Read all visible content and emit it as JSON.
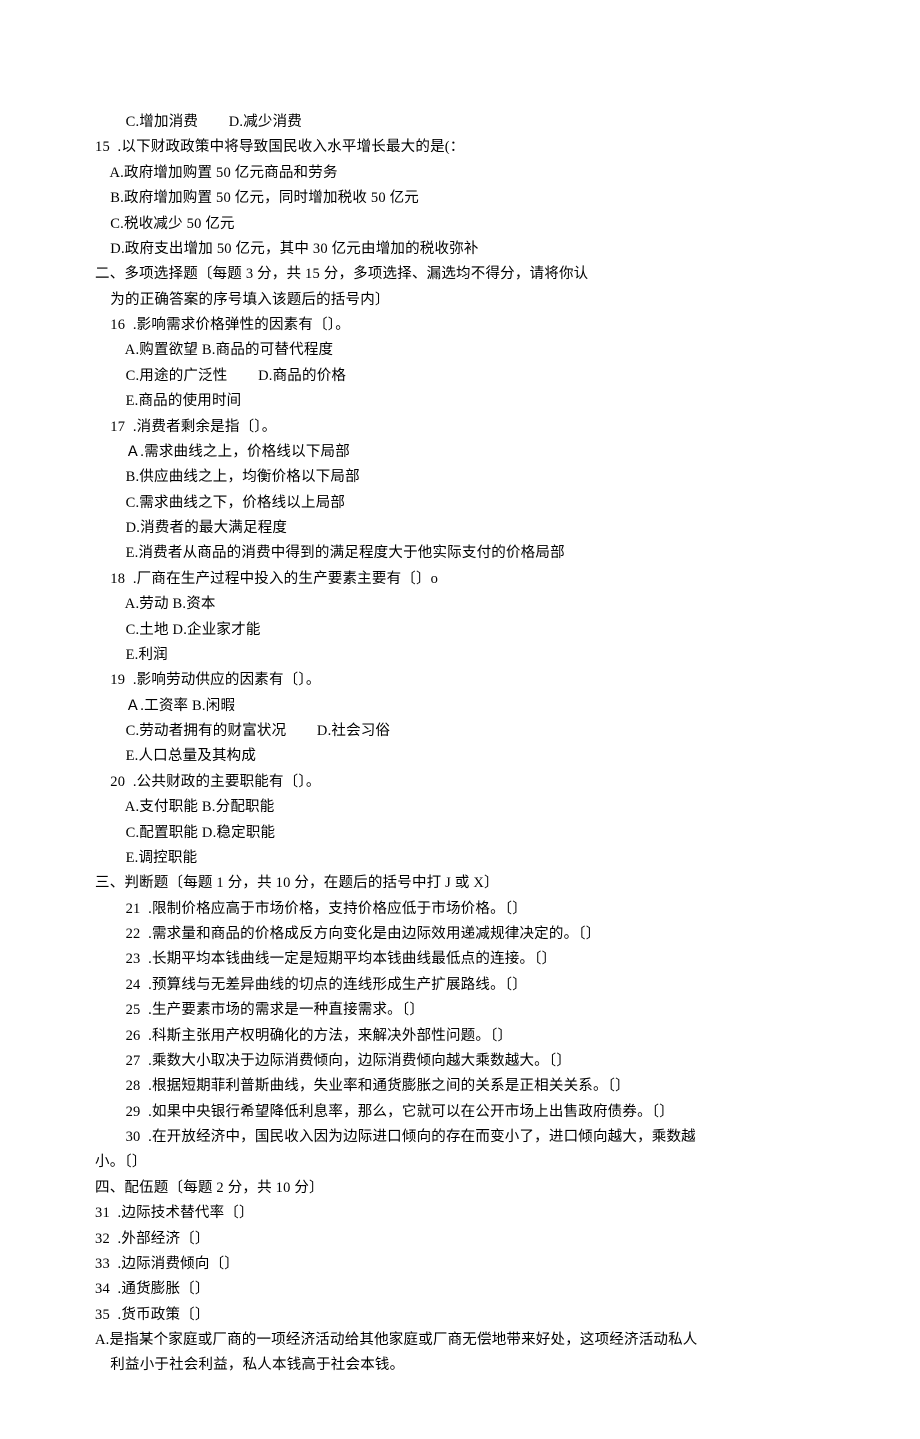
{
  "lines": [
    "        C.增加消费        D.减少消费",
    "15  .以下财政政策中将导致国民收入水平增长最大的是(：",
    "    A.政府增加购置 50 亿元商品和劳务",
    "    B.政府增加购置 50 亿元，同时增加税收 50 亿元",
    "    C.税收减少 50 亿元",
    "    D.政府支出增加 50 亿元，其中 30 亿元由增加的税收弥补",
    "二、多项选择题〔每题 3 分，共 15 分，多项选择、漏选均不得分，请将你认",
    "    为的正确答案的序号填入该题后的括号内〕",
    "    16  .影响需求价格弹性的因素有〔〕。",
    "        A.购置欲望 B.商品的可替代程度",
    "        C.用途的广泛性        D.商品的价格",
    "        E.商品的使用时间",
    "    17  .消费者剩余是指〔〕。",
    "        Ａ.需求曲线之上，价格线以下局部",
    "        B.供应曲线之上，均衡价格以下局部",
    "        C.需求曲线之下，价格线以上局部",
    "        D.消费者的最大满足程度",
    "        E.消费者从商品的消费中得到的满足程度大于他实际支付的价格局部",
    "    18  .厂商在生产过程中投入的生产要素主要有〔〕o",
    "        A.劳动 B.资本",
    "        C.土地 D.企业家才能",
    "        E.利润",
    "    19  .影响劳动供应的因素有〔〕。",
    "        Ａ.工资率 B.闲暇",
    "        C.劳动者拥有的财富状况        D.社会习俗",
    "        E.人口总量及其构成",
    "    20  .公共财政的主要职能有〔〕。",
    "        A.支付职能 B.分配职能",
    "        C.配置职能 D.稳定职能",
    "        E.调控职能",
    "三、判断题〔每题 1 分，共 10 分，在题后的括号中打 J 或 X〕",
    "        21  .限制价格应高于市场价格，支持价格应低于市场价格。〔〕",
    "        22  .需求量和商品的价格成反方向变化是由边际效用递减规律决定的。〔〕",
    "        23  .长期平均本钱曲线一定是短期平均本钱曲线最低点的连接。〔〕",
    "        24  .预算线与无差异曲线的切点的连线形成生产扩展路线。〔〕",
    "        25  .生产要素市场的需求是一种直接需求。〔〕",
    "        26  .科斯主张用产权明确化的方法，来解决外部性问题。〔〕",
    "        27  .乘数大小取决于边际消费倾向，边际消费倾向越大乘数越大。〔〕",
    "        28  .根据短期菲利普斯曲线，失业率和通货膨胀之间的关系是正相关关系。〔〕",
    "        29  .如果中央银行希望降低利息率，那么，它就可以在公开市场上出售政府债券。〔〕",
    "        30  .在开放经济中，国民收入因为边际进口倾向的存在而变小了，进口倾向越大，乘数越",
    "小。〔〕",
    "四、配伍题〔每题 2 分，共 10 分〕",
    "31  .边际技术替代率〔〕",
    "32  .外部经济〔〕",
    "33  .边际消费倾向〔〕",
    "34  .通货膨胀〔〕",
    "35  .货币政策〔〕",
    "A.是指某个家庭或厂商的一项经济活动给其他家庭或厂商无偿地带来好处，这项经济活动私人",
    "    利益小于社会利益，私人本钱高于社会本钱。"
  ]
}
